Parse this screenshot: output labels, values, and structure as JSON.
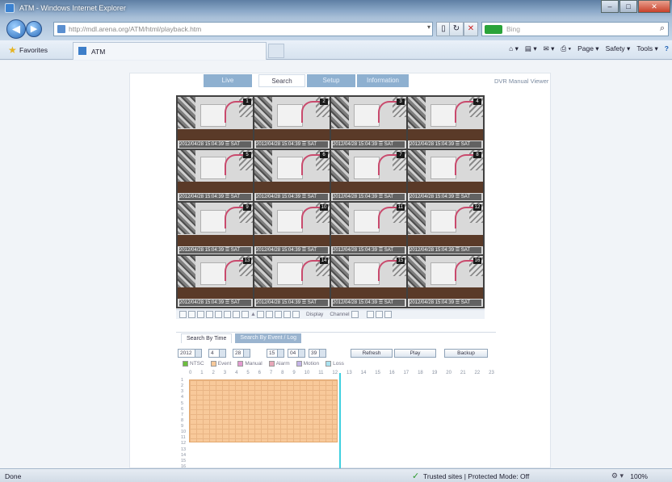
{
  "window": {
    "title": "ATM - Windows Internet Explorer",
    "controls": {
      "minimize": "–",
      "maximize": "□",
      "close": "✕"
    }
  },
  "address_bar": {
    "url": "http://mdl.arena.org/ATM/html/playback.htm",
    "search_placeholder": "Bing"
  },
  "favorites_bar": {
    "favorites_label": "Favorites",
    "tab_title": "ATM"
  },
  "command_bar": {
    "page_label": "Page ▾",
    "safety_label": "Safety ▾",
    "tools_label": "Tools ▾",
    "help_label": "?"
  },
  "app_nav": {
    "tabs": [
      "Live",
      "Search",
      "Setup",
      "Information"
    ],
    "active_tab": "Search",
    "manual_link": "DVR Manual Viewer"
  },
  "camera_grid": {
    "camera_numbers": [
      "1",
      "2",
      "3",
      "4",
      "5",
      "6",
      "7",
      "8",
      "9",
      "10",
      "11",
      "12",
      "13",
      "14",
      "15",
      "16"
    ],
    "osd_text": "2012/04/28 15:04:39 ☰ SAT"
  },
  "video_toolbar": {
    "display_label": "Display",
    "channel_label": "Channel"
  },
  "search_panel": {
    "tabs": [
      "Search By Time",
      "Search By Event / Log"
    ],
    "active_tab": "Search By Time",
    "year": "2012",
    "month": "4",
    "day": "28",
    "hour": "15",
    "minute": "04",
    "second": "39",
    "buttons": [
      "Refresh",
      "Play",
      "Backup"
    ],
    "legend": [
      "NTSC",
      "Event",
      "Manual",
      "Alarm",
      "Motion",
      "Loss"
    ],
    "hour_ticks": [
      "0",
      "1",
      "2",
      "3",
      "4",
      "5",
      "6",
      "7",
      "8",
      "9",
      "10",
      "11",
      "12",
      "13",
      "14",
      "15",
      "16",
      "17",
      "18",
      "19",
      "20",
      "21",
      "22",
      "23"
    ],
    "channel_rows": [
      "1",
      "2",
      "3",
      "4",
      "5",
      "6",
      "7",
      "8",
      "9",
      "10",
      "11",
      "12",
      "13",
      "14",
      "15",
      "16"
    ]
  },
  "colors": {
    "record_block": "#f8c99a",
    "time_cursor": "#3fd0e0",
    "active_tab_bg": "#ffffff",
    "inactive_tab_bg": "#8eb0d0"
  },
  "status_bar": {
    "status": "Done",
    "zone": "Trusted sites | Protected Mode: Off",
    "zoom": "100%"
  }
}
